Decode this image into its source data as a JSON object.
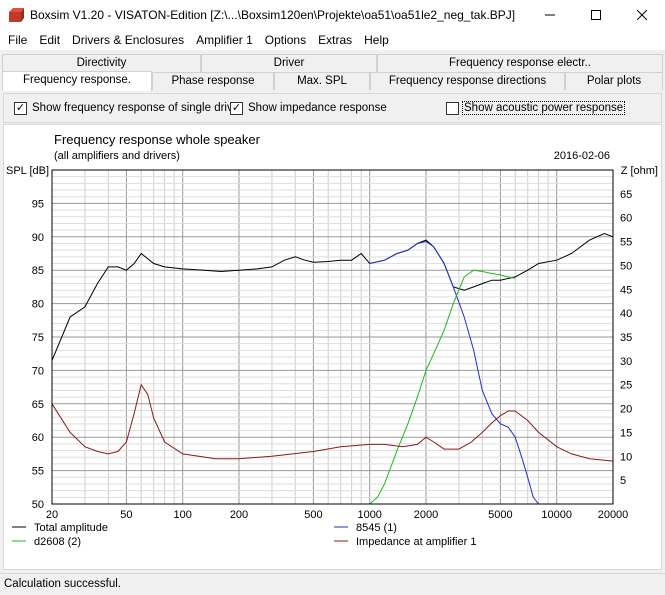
{
  "window": {
    "title": "Boxsim V1.20 - VISATON-Edition [Z:\\...\\Boxsim120en\\Projekte\\oa51\\oa51le2_neg_tak.BPJ]"
  },
  "menu": [
    "File",
    "Edit",
    "Drivers & Enclosures",
    "Amplifier 1",
    "Options",
    "Extras",
    "Help"
  ],
  "tabs": {
    "row_back": [
      "Directivity",
      "Driver",
      "Frequency response electr.."
    ],
    "row_front": [
      "Frequency response.",
      "Phase response",
      "Max. SPL",
      "Frequency response directions",
      "Polar plots"
    ],
    "active": "Frequency response."
  },
  "options": {
    "single_drive": {
      "label": "Show frequency response of single drive",
      "checked": true
    },
    "impedance": {
      "label": "Show impedance response",
      "checked": true
    },
    "acoustic_power": {
      "label": "Show acoustic power response",
      "checked": false
    }
  },
  "status": "Calculation successful.",
  "chart_data": {
    "type": "line",
    "title": "Frequency response whole speaker",
    "subtitle": "(all amplifiers and drivers)",
    "date": "2016-02-06",
    "ylabel": "SPL [dB]",
    "y2label": "Z [ohm]",
    "x_scale": "log",
    "xlim": [
      20,
      20000
    ],
    "ylim": [
      50,
      100
    ],
    "y2lim": [
      0,
      70
    ],
    "x_ticks": [
      "20",
      "50",
      "100",
      "200",
      "500",
      "1000",
      "2000",
      "5000",
      "10000",
      "20000"
    ],
    "y_ticks": [
      "50",
      "55",
      "60",
      "65",
      "70",
      "75",
      "80",
      "85",
      "90",
      "95"
    ],
    "y2_ticks": [
      "5",
      "10",
      "15",
      "20",
      "25",
      "30",
      "35",
      "40",
      "45",
      "50",
      "55",
      "60",
      "65"
    ],
    "grid": true,
    "series": [
      {
        "name": "Total amplitude",
        "axis": "left",
        "color": "#000000",
        "x": [
          20,
          25,
          30,
          35,
          40,
          45,
          50,
          55,
          60,
          70,
          80,
          100,
          130,
          160,
          200,
          250,
          300,
          350,
          400,
          450,
          500,
          600,
          700,
          800,
          900,
          1000,
          1200,
          1400,
          1600,
          1800,
          2000,
          2200,
          2500,
          2800,
          3200,
          3600,
          4000,
          4500,
          5000,
          6000,
          7000,
          8000,
          10000,
          12000,
          15000,
          18000,
          20000
        ],
        "y": [
          71.5,
          78,
          79.5,
          83,
          85.5,
          85.5,
          85,
          86,
          87.5,
          86,
          85.5,
          85.2,
          85,
          84.8,
          85,
          85.2,
          85.5,
          86.5,
          87,
          86.5,
          86.2,
          86.3,
          86.5,
          86.5,
          87.5,
          86,
          86.5,
          87.5,
          88,
          89,
          89.5,
          88.5,
          86,
          82.5,
          82,
          82.5,
          83,
          83.5,
          83.5,
          84,
          85,
          86,
          86.5,
          87.5,
          89.5,
          90.5,
          90
        ]
      },
      {
        "name": "8545 (1)",
        "axis": "left",
        "color": "#1f2fd1",
        "x": [
          1000,
          1200,
          1400,
          1600,
          1800,
          2000,
          2200,
          2500,
          2800,
          3200,
          3600,
          4000,
          4500,
          5000,
          5500,
          6000,
          6500,
          7000,
          7500,
          8000,
          20000
        ],
        "y": [
          86,
          86.5,
          87.5,
          88,
          89,
          89.3,
          88.5,
          86,
          82.5,
          78,
          73,
          67,
          63.5,
          62,
          61.5,
          60,
          57,
          54,
          51,
          50,
          50
        ]
      },
      {
        "name": "d2608  (2)",
        "axis": "left",
        "color": "#1fb81f",
        "x": [
          20,
          1000,
          1100,
          1200,
          1400,
          1600,
          1800,
          2000,
          2200,
          2500,
          2800,
          3200,
          3600,
          4000,
          4500,
          5000,
          5500,
          6000
        ],
        "y": [
          50,
          50,
          51,
          53,
          58,
          62,
          66,
          70,
          72.5,
          76,
          80,
          84,
          85,
          84.8,
          84.5,
          84.3,
          84,
          83.8
        ]
      },
      {
        "name": "Impedance at amplifier 1",
        "axis": "right",
        "color": "#8b1a1a",
        "x": [
          20,
          25,
          30,
          35,
          40,
          45,
          50,
          55,
          60,
          65,
          70,
          80,
          100,
          150,
          200,
          300,
          500,
          700,
          1000,
          1200,
          1500,
          1800,
          2000,
          2200,
          2500,
          3000,
          3500,
          4000,
          4500,
          5000,
          5500,
          6000,
          7000,
          8000,
          10000,
          12000,
          15000,
          20000
        ],
        "y": [
          21,
          15,
          12,
          11,
          10.5,
          11,
          13,
          19,
          25,
          23,
          18,
          13,
          10.5,
          9.5,
          9.5,
          10,
          11,
          12,
          12.5,
          12.5,
          12,
          12.5,
          14,
          13,
          11.5,
          11.5,
          13,
          15,
          17,
          18.5,
          19.5,
          19.5,
          17.5,
          15,
          12,
          10.5,
          9.5,
          9
        ]
      }
    ],
    "legend": [
      "Total amplitude",
      "8545 (1)",
      "d2608  (2)",
      "Impedance at amplifier 1"
    ],
    "legend_placement": "bottom"
  }
}
